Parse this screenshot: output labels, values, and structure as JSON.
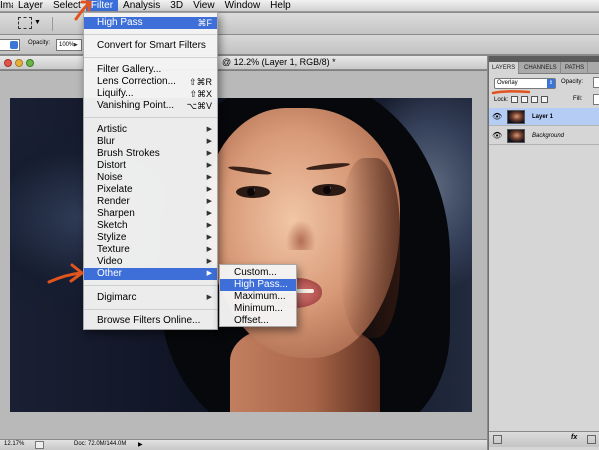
{
  "menubar": {
    "items": [
      {
        "label": "Image"
      },
      {
        "label": "Layer"
      },
      {
        "label": "Select"
      },
      {
        "label": "Filter"
      },
      {
        "label": "Analysis"
      },
      {
        "label": "3D"
      },
      {
        "label": "View"
      },
      {
        "label": "Window"
      },
      {
        "label": "Help"
      }
    ],
    "active_index": 3
  },
  "options_bar": {
    "opacity_label": "Opacity:",
    "opacity_value": "100%"
  },
  "document": {
    "title": "@ 12.2% (Layer 1, RGB/8) *",
    "zoom": "12.17%",
    "doc_info": "Doc: 72.0M/144.0M"
  },
  "filter_menu": {
    "last_filter": {
      "label": "High Pass",
      "shortcut": "⌘F"
    },
    "convert": "Convert for Smart Filters",
    "top_items": [
      {
        "label": "Filter Gallery...",
        "shortcut": ""
      },
      {
        "label": "Lens Correction...",
        "shortcut": "⇧⌘R"
      },
      {
        "label": "Liquify...",
        "shortcut": "⇧⌘X"
      },
      {
        "label": "Vanishing Point...",
        "shortcut": "⌥⌘V"
      }
    ],
    "categories": [
      {
        "label": "Artistic"
      },
      {
        "label": "Blur"
      },
      {
        "label": "Brush Strokes"
      },
      {
        "label": "Distort"
      },
      {
        "label": "Noise"
      },
      {
        "label": "Pixelate"
      },
      {
        "label": "Render"
      },
      {
        "label": "Sharpen"
      },
      {
        "label": "Sketch"
      },
      {
        "label": "Stylize"
      },
      {
        "label": "Texture"
      },
      {
        "label": "Video"
      },
      {
        "label": "Other"
      }
    ],
    "digimarc": "Digimarc",
    "browse_online": "Browse Filters Online..."
  },
  "other_submenu": {
    "items": [
      {
        "label": "Custom..."
      },
      {
        "label": "High Pass..."
      },
      {
        "label": "Maximum..."
      },
      {
        "label": "Minimum..."
      },
      {
        "label": "Offset..."
      }
    ],
    "highlighted_index": 1
  },
  "layers_panel": {
    "tabs": [
      "LAYERS",
      "CHANNELS",
      "PATHS"
    ],
    "blend_mode": "Overlay",
    "opacity_label": "Opacity:",
    "lock_label": "Lock:",
    "fill_label": "Fill:",
    "layers": [
      {
        "name": "Layer 1",
        "selected": true
      },
      {
        "name": "Background",
        "selected": false
      }
    ],
    "bottom_icon": "fx"
  },
  "colors": {
    "menu_highlight": "#3e6fd8",
    "annotation_arrow": "#e0541e",
    "selected_layer": "#b5cdf4"
  }
}
